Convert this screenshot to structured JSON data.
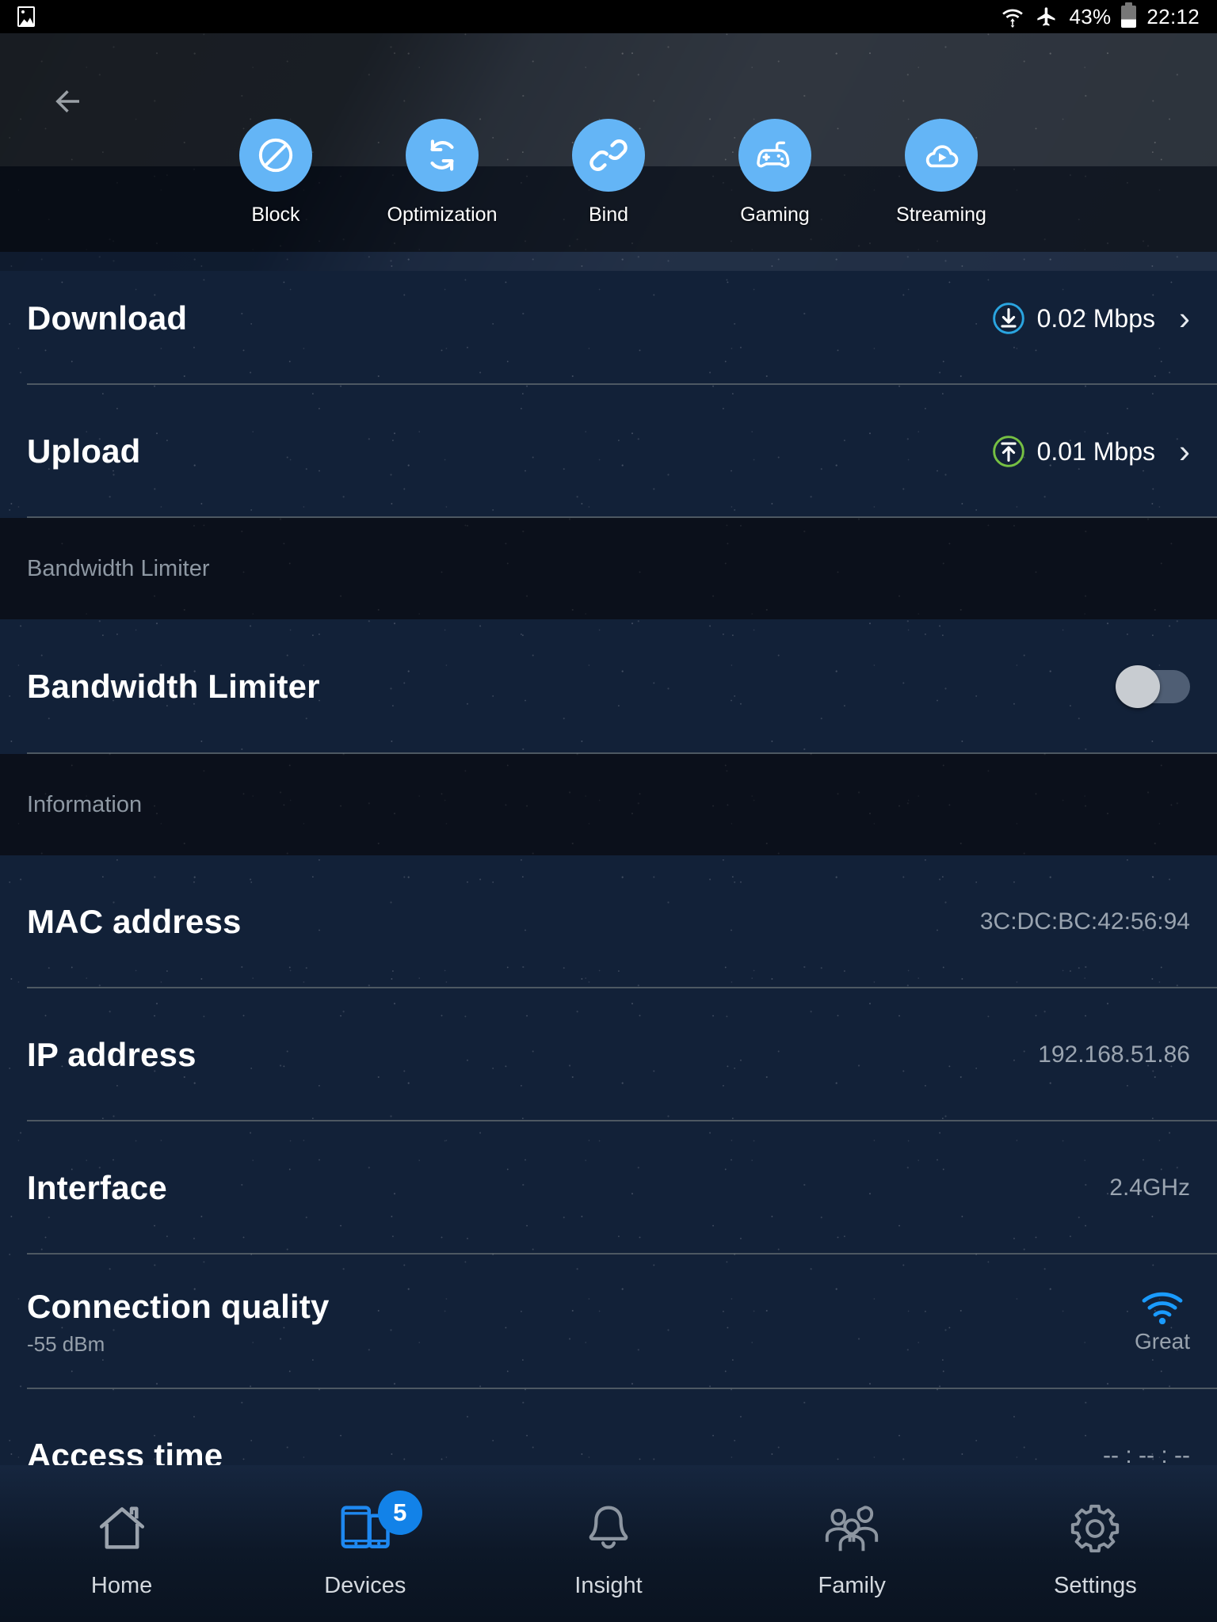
{
  "statusbar": {
    "photo_icon": "image-icon",
    "wifi_icon": "wifi-transfer-icon",
    "airplane_icon": "airplane-mode-icon",
    "battery_percent": "43%",
    "battery_icon": "battery-icon",
    "time": "22:12"
  },
  "header": {
    "back_icon": "back-arrow-icon"
  },
  "actions": [
    {
      "label": "Block",
      "icon": "block-icon"
    },
    {
      "label": "Optimization",
      "icon": "refresh-icon"
    },
    {
      "label": "Bind",
      "icon": "link-icon"
    },
    {
      "label": "Gaming",
      "icon": "gamepad-icon"
    },
    {
      "label": "Streaming",
      "icon": "cloud-play-icon"
    }
  ],
  "speed": {
    "download": {
      "label": "Download",
      "value": "0.02 Mbps",
      "icon": "download-circle-icon",
      "chevron": "›"
    },
    "upload": {
      "label": "Upload",
      "value": "0.01 Mbps",
      "icon": "upload-circle-icon",
      "chevron": "›"
    }
  },
  "bandwidth_section": {
    "header": "Bandwidth Limiter",
    "row_label": "Bandwidth Limiter",
    "toggle_state": "off"
  },
  "information_section": {
    "header": "Information",
    "rows": [
      {
        "label": "MAC address",
        "value": "3C:DC:BC:42:56:94"
      },
      {
        "label": "IP address",
        "value": "192.168.51.86"
      },
      {
        "label": "Interface",
        "value": "2.4GHz"
      }
    ],
    "connection_quality": {
      "label": "Connection quality",
      "sub": "-55 dBm",
      "icon": "wifi-signal-icon",
      "quality": "Great"
    },
    "access_time": {
      "label": "Access time",
      "value": "-- : -- : --"
    }
  },
  "navbar": [
    {
      "label": "Home",
      "icon": "home-icon",
      "active": false,
      "badge": ""
    },
    {
      "label": "Devices",
      "icon": "devices-icon",
      "active": true,
      "badge": "5"
    },
    {
      "label": "Insight",
      "icon": "bell-icon",
      "active": false,
      "badge": ""
    },
    {
      "label": "Family",
      "icon": "family-icon",
      "active": false,
      "badge": ""
    },
    {
      "label": "Settings",
      "icon": "gear-icon",
      "active": false,
      "badge": ""
    }
  ],
  "colors": {
    "accent_blue": "#64b5f6",
    "active_blue": "#1282e8",
    "upload_green": "#76c043",
    "download_blue": "#2aa5e0",
    "row_bg": "#14233e",
    "header_bg": "#0a0e17"
  }
}
